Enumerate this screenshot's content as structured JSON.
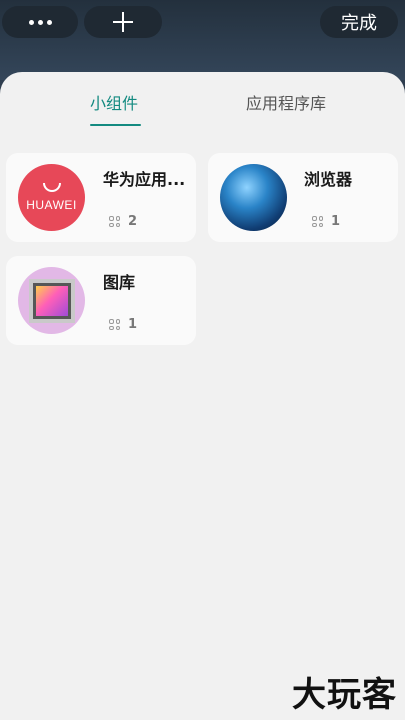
{
  "toolbar": {
    "more_icon": "more-dots-icon",
    "add_icon": "plus-icon",
    "done_label": "完成"
  },
  "tabs": [
    {
      "label": "小组件",
      "active": true
    },
    {
      "label": "应用程序库",
      "active": false
    }
  ],
  "accent_color": "#138a80",
  "apps": [
    {
      "title": "华为应用...",
      "icon_text": "HUAWEI",
      "icon": "huawei-appgallery-icon",
      "widget_count": "2"
    },
    {
      "title": "浏览器",
      "icon": "globe-browser-icon",
      "widget_count": "1"
    },
    {
      "title": "图库",
      "icon": "gallery-photo-icon",
      "widget_count": "1"
    }
  ],
  "watermark": "大玩客"
}
